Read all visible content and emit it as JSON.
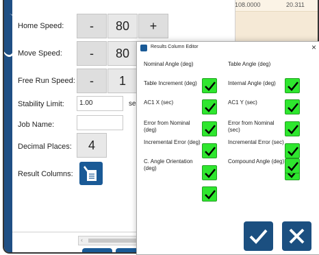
{
  "background": {
    "values": [
      "108.0000",
      "20.311"
    ]
  },
  "settings": {
    "home_speed": {
      "label": "Home Speed:",
      "minus": "-",
      "value": "80",
      "plus": "+"
    },
    "move_speed": {
      "label": "Move Speed:",
      "minus": "-",
      "value": "80"
    },
    "free_run_speed": {
      "label": "Free Run Speed:",
      "minus": "-",
      "value": "1"
    },
    "stability_limit": {
      "label": "Stability Limit:",
      "value": "1.00",
      "unit": "sec"
    },
    "job_name": {
      "label": "Job Name:",
      "value": ""
    },
    "decimal_places": {
      "label": "Decimal Places:",
      "value": "4"
    },
    "result_columns": {
      "label": "Result Columns:"
    }
  },
  "dialog": {
    "title": "Results Column Editor",
    "close": "×",
    "left_column": [
      {
        "label": "Nominal Angle (deg)",
        "checked": true
      },
      {
        "label": "Table Increment (deg)",
        "checked": true
      },
      {
        "label": "AC1 X (sec)",
        "checked": true
      },
      {
        "label": "Error from Nominal (deg)",
        "checked": true
      },
      {
        "label": "Incremental Error (deg)",
        "checked": true
      },
      {
        "label": "C. Angle Orientation (deg)",
        "checked": true
      }
    ],
    "right_column": [
      {
        "label": "Table Angle (deg)",
        "checked": true
      },
      {
        "label": "Internal Angle (deg)",
        "checked": true
      },
      {
        "label": "AC1 Y (sec)",
        "checked": true
      },
      {
        "label": "Error from Nominal (sec)",
        "checked": true
      },
      {
        "label": "Incremental Error (sec)",
        "checked": true
      },
      {
        "label": "Compound Angle (deg)",
        "checked": true
      }
    ],
    "check_color": "#2ee62e",
    "button_color": "#1b4f80"
  }
}
